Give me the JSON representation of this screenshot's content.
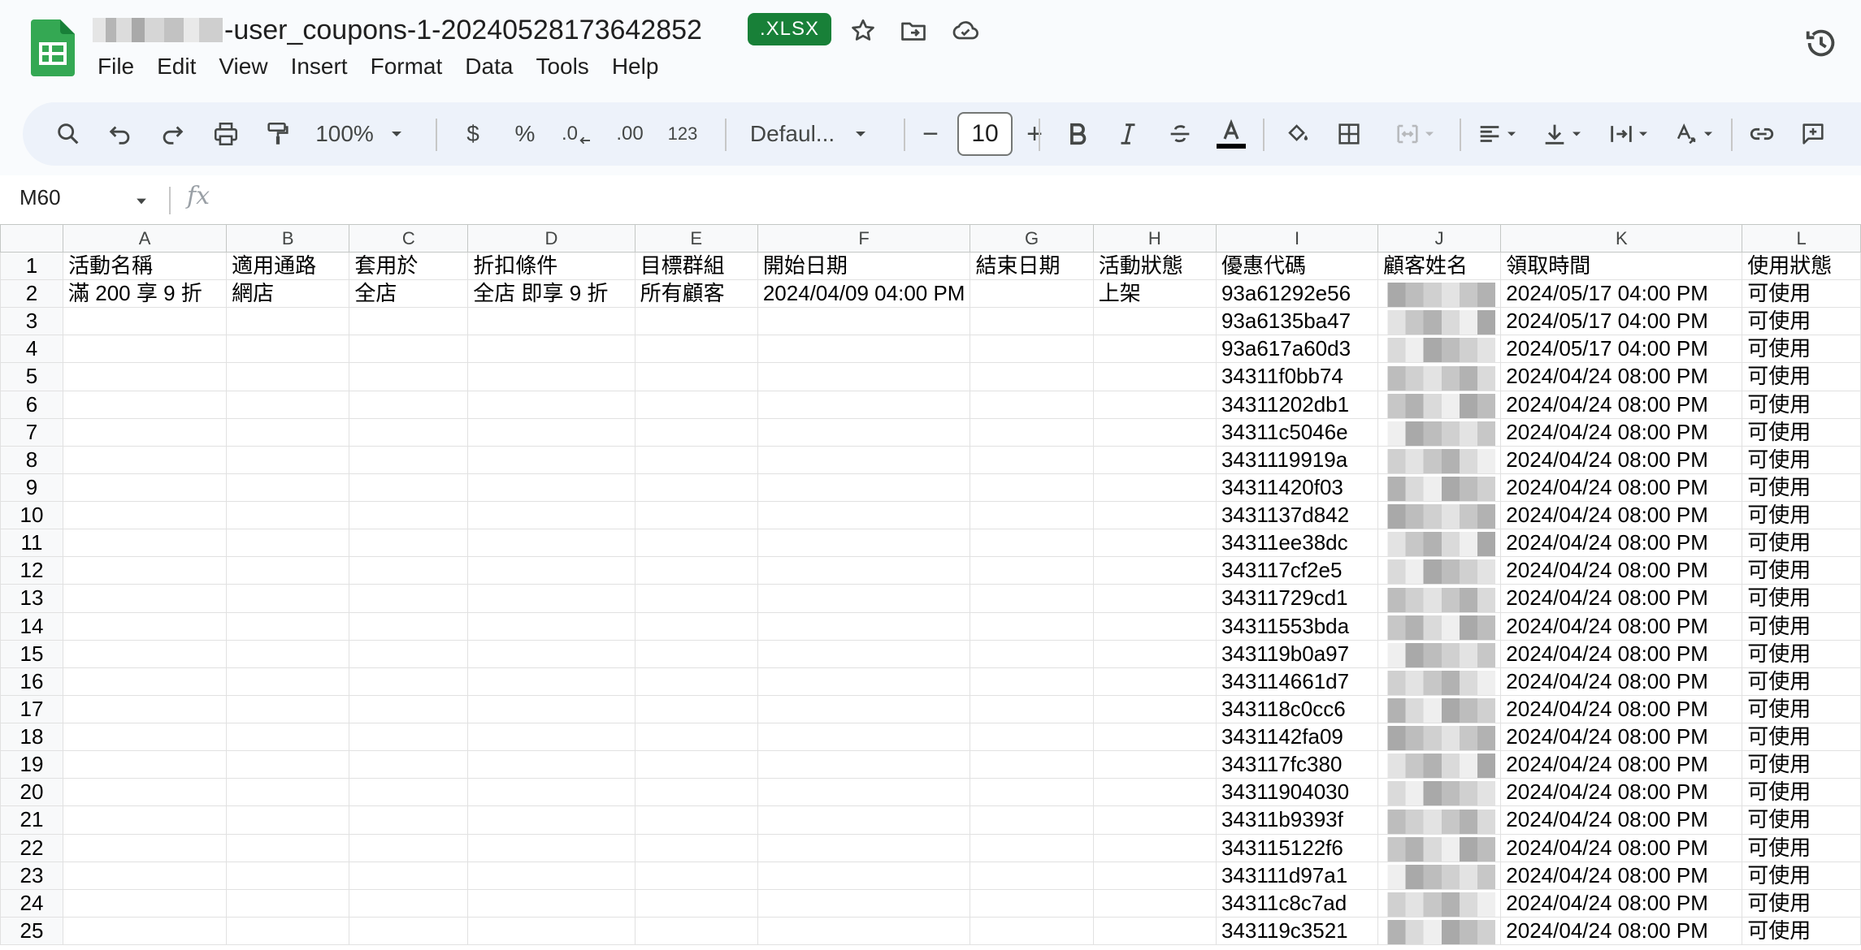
{
  "document": {
    "title": "-user_coupons-1-20240528173642852",
    "file_type": ".XLSX"
  },
  "menu": [
    "File",
    "Edit",
    "View",
    "Insert",
    "Format",
    "Data",
    "Tools",
    "Help"
  ],
  "toolbar": {
    "zoom": "100%",
    "currency": "$",
    "percent": "%",
    "decrease_decimal": ".0",
    "increase_decimal": ".00",
    "number_format": "123",
    "font": "Defaul...",
    "font_size": "10",
    "minus": "−",
    "plus": "+"
  },
  "formula_bar": {
    "cell_ref": "M60",
    "fx": "fx",
    "value": ""
  },
  "columns": [
    "A",
    "B",
    "C",
    "D",
    "E",
    "F",
    "G",
    "H",
    "I",
    "J",
    "K",
    "L"
  ],
  "header_row": [
    "活動名稱",
    "適用通路",
    "套用於",
    "折扣條件",
    "目標群組",
    "開始日期",
    "結束日期",
    "活動狀態",
    "優惠代碼",
    "顧客姓名",
    "領取時間",
    "使用狀態"
  ],
  "first_data_row": [
    "滿 200 享 9 折",
    "網店",
    "全店",
    "全店 即享 9 折",
    "所有顧客",
    "2024/04/09 04:00 PM",
    "",
    "上架"
  ],
  "rows": [
    {
      "n": "2",
      "code": "93a61292e56",
      "time": "2024/05/17 04:00 PM",
      "status": "可使用"
    },
    {
      "n": "3",
      "code": "93a6135ba47",
      "time": "2024/05/17 04:00 PM",
      "status": "可使用"
    },
    {
      "n": "4",
      "code": "93a617a60d3",
      "time": "2024/05/17 04:00 PM",
      "status": "可使用"
    },
    {
      "n": "5",
      "code": "34311f0bb74",
      "time": "2024/04/24 08:00 PM",
      "status": "可使用"
    },
    {
      "n": "6",
      "code": "34311202db1",
      "time": "2024/04/24 08:00 PM",
      "status": "可使用"
    },
    {
      "n": "7",
      "code": "34311c5046e",
      "time": "2024/04/24 08:00 PM",
      "status": "可使用"
    },
    {
      "n": "8",
      "code": "3431119919a",
      "time": "2024/04/24 08:00 PM",
      "status": "可使用"
    },
    {
      "n": "9",
      "code": "34311420f03",
      "time": "2024/04/24 08:00 PM",
      "status": "可使用"
    },
    {
      "n": "10",
      "code": "3431137d842",
      "time": "2024/04/24 08:00 PM",
      "status": "可使用"
    },
    {
      "n": "11",
      "code": "34311ee38dc",
      "time": "2024/04/24 08:00 PM",
      "status": "可使用"
    },
    {
      "n": "12",
      "code": "343117cf2e5",
      "time": "2024/04/24 08:00 PM",
      "status": "可使用"
    },
    {
      "n": "13",
      "code": "34311729cd1",
      "time": "2024/04/24 08:00 PM",
      "status": "可使用"
    },
    {
      "n": "14",
      "code": "34311553bda",
      "time": "2024/04/24 08:00 PM",
      "status": "可使用"
    },
    {
      "n": "15",
      "code": "343119b0a97",
      "time": "2024/04/24 08:00 PM",
      "status": "可使用"
    },
    {
      "n": "16",
      "code": "343114661d7",
      "time": "2024/04/24 08:00 PM",
      "status": "可使用"
    },
    {
      "n": "17",
      "code": "343118c0cc6",
      "time": "2024/04/24 08:00 PM",
      "status": "可使用"
    },
    {
      "n": "18",
      "code": "3431142fa09",
      "time": "2024/04/24 08:00 PM",
      "status": "可使用"
    },
    {
      "n": "19",
      "code": "343117fc380",
      "time": "2024/04/24 08:00 PM",
      "status": "可使用"
    },
    {
      "n": "20",
      "code": "34311904030",
      "time": "2024/04/24 08:00 PM",
      "status": "可使用"
    },
    {
      "n": "21",
      "code": "34311b9393f",
      "time": "2024/04/24 08:00 PM",
      "status": "可使用"
    },
    {
      "n": "22",
      "code": "343115122f6",
      "time": "2024/04/24 08:00 PM",
      "status": "可使用"
    },
    {
      "n": "23",
      "code": "343111d97a1",
      "time": "2024/04/24 08:00 PM",
      "status": "可使用"
    },
    {
      "n": "24",
      "code": "34311c8c7ad",
      "time": "2024/04/24 08:00 PM",
      "status": "可使用"
    },
    {
      "n": "25",
      "code": "343119c3521",
      "time": "2024/04/24 08:00 PM",
      "status": "可使用"
    }
  ],
  "icons": {
    "app": "google-sheets-icon",
    "star": "star-icon",
    "move": "folder-move-icon",
    "cloud": "cloud-done-icon",
    "history": "history-icon"
  },
  "colors": {
    "sheets_green": "#34a853",
    "xlsx_badge": "#188038",
    "toolbar_bg": "#edf2fa",
    "header_bg": "#f8f9fa"
  }
}
